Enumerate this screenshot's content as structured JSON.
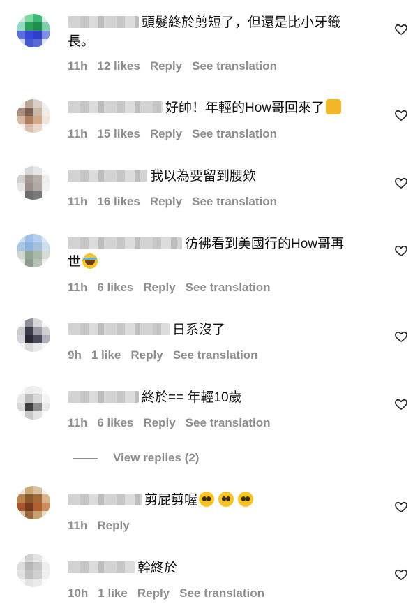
{
  "comments": [
    {
      "text": "頭髮終於剪短了，但還是比小牙籤",
      "text2": "長。",
      "time": "11h",
      "likes": "12 likes",
      "reply": "Reply",
      "translate": "See translation",
      "avatar_colors": [
        "#cfe8e0",
        "#7fd8a0",
        "#3fb87a",
        "#d5efe5",
        "#8fdcbf",
        "#2aa35a",
        "#1e8f4e",
        "#7fd0a8",
        "#5b6fe0",
        "#3848d8",
        "#2f3fc8",
        "#7f8fe8",
        "#d0d6f0",
        "#4558d0",
        "#5a69d8",
        "#e0e5f5"
      ]
    },
    {
      "text": "好帥！年輕的How哥回來了",
      "time": "11h",
      "likes": "15 likes",
      "reply": "Reply",
      "translate": "See translation",
      "avatar_colors": [
        "#f0f0f0",
        "#b9a79a",
        "#d8cfc8",
        "#efefef",
        "#a88f80",
        "#7b6152",
        "#c9b7a8",
        "#f3ece6",
        "#d6b8a2",
        "#b07e60",
        "#d4a98a",
        "#f0e5dc",
        "#f5f0ec",
        "#d9c0ae",
        "#e8d8cc",
        "#fafafa"
      ]
    },
    {
      "text": "我以為要留到腰欸",
      "time": "11h",
      "likes": "16 likes",
      "reply": "Reply",
      "translate": "See translation",
      "avatar_colors": [
        "#f7f7f7",
        "#d8d8d8",
        "#e6e6e6",
        "#fafafa",
        "#d0d0d0",
        "#a59b96",
        "#b8aeaa",
        "#eeeeee",
        "#e5e5e5",
        "#9a8f8a",
        "#b3a9a4",
        "#f2f2f2",
        "#f5f5f5",
        "#6e6e6e",
        "#7a7a7a",
        "#f8f8f8"
      ]
    },
    {
      "text": "彷彿看到美國行的How哥再",
      "text2": "世",
      "time": "11h",
      "likes": "6 likes",
      "reply": "Reply",
      "translate": "See translation",
      "avatar_colors": [
        "#c8dcef",
        "#9cc0e6",
        "#b5d0ee",
        "#dce8f4",
        "#a9c6e5",
        "#8fb4df",
        "#a6c0dc",
        "#cfdceb",
        "#cdd7cf",
        "#93a596",
        "#a9b6aa",
        "#d4dad4",
        "#e8ece8",
        "#8e9a8e",
        "#b8c1b8",
        "#eef0ee"
      ]
    },
    {
      "text": "日系沒了",
      "time": "9h",
      "likes": "1 like",
      "reply": "Reply",
      "translate": "See translation",
      "avatar_colors": [
        "#f4f4f4",
        "#8e8e96",
        "#d8d8dc",
        "#f7f7f7",
        "#c9c9ce",
        "#3c3c4a",
        "#9a9aa6",
        "#cfcfd4",
        "#d2d2d8",
        "#2a2a36",
        "#4a4a5a",
        "#b0b0ba",
        "#f6f6f6",
        "#d8d8dc",
        "#e9e9ec",
        "#fafafa"
      ]
    },
    {
      "text": "終於== 年輕10歲",
      "time": "11h",
      "likes": "6 likes",
      "reply": "Reply",
      "translate": "See translation",
      "avatar_colors": [
        "#f8f8f8",
        "#ececec",
        "#efefef",
        "#fafafa",
        "#e8e8e8",
        "#bcbcbc",
        "#dadada",
        "#f4f4f4",
        "#d8d8d8",
        "#3e3e3e",
        "#8c8c8c",
        "#e8e8e8",
        "#f6f6f6",
        "#c8c8c8",
        "#e2e2e2",
        "#fbfbfb"
      ]
    },
    {
      "text": "剪屁剪喔",
      "time": "11h",
      "reply": "Reply",
      "avatar_colors": [
        "#efe6d8",
        "#c9a87a",
        "#d8c0a0",
        "#f4eee4",
        "#b8854e",
        "#8a5a2e",
        "#a46a3a",
        "#d9b48c",
        "#a8542e",
        "#7a3a1e",
        "#b0602e",
        "#cc8e5a",
        "#d6c3a8",
        "#9a6a3e",
        "#c8a06e",
        "#e8dcc8"
      ]
    },
    {
      "text": "幹終於",
      "time": "10h",
      "likes": "1 like",
      "reply": "Reply",
      "translate": "See translation",
      "avatar_colors": [
        "#f5f5f5",
        "#d2d2d2",
        "#e3e3e3",
        "#f8f8f8",
        "#dcdcdc",
        "#b8b8b8",
        "#c8c8c8",
        "#eeeeee",
        "#e2e2e2",
        "#c0c0c0",
        "#d0d0d0",
        "#f0f0f0",
        "#f6f6f6",
        "#e4e4e4",
        "#ebebeb",
        "#fafafa"
      ]
    }
  ],
  "view_replies": "View replies (2)",
  "icons": {
    "like": "heart-outline-icon",
    "emoji_thumb": "thumbs-up-emoji",
    "emoji_laugh": "tears-of-joy-emoji",
    "emoji_plead": "pleading-face-emoji"
  },
  "colors": {
    "meta_text": "#8e8e8e",
    "text": "#111111"
  }
}
